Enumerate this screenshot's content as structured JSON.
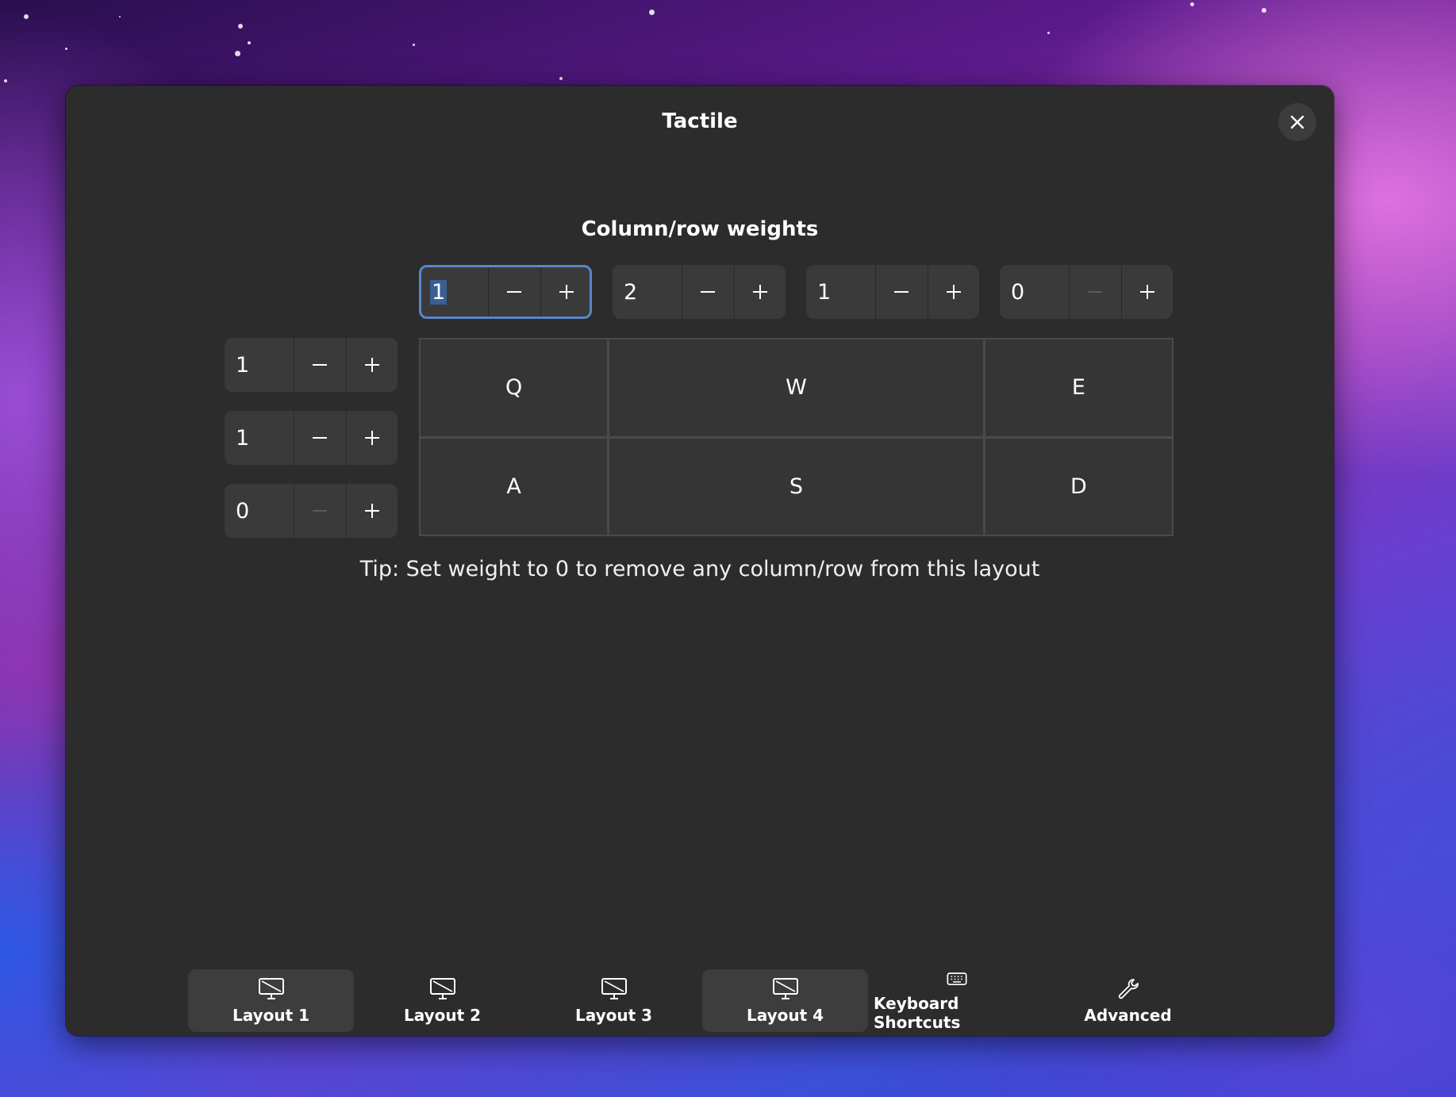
{
  "window": {
    "title": "Tactile",
    "close_icon": "close-icon"
  },
  "weights": {
    "title": "Column/row weights",
    "columns": [
      {
        "value": "1",
        "focused": true,
        "minus_enabled": true
      },
      {
        "value": "2",
        "focused": false,
        "minus_enabled": true
      },
      {
        "value": "1",
        "focused": false,
        "minus_enabled": true
      },
      {
        "value": "0",
        "focused": false,
        "minus_enabled": false
      }
    ],
    "rows": [
      {
        "value": "1",
        "minus_enabled": true
      },
      {
        "value": "1",
        "minus_enabled": true
      },
      {
        "value": "0",
        "minus_enabled": false
      }
    ]
  },
  "grid": {
    "cells": [
      "Q",
      "W",
      "E",
      "A",
      "S",
      "D"
    ]
  },
  "tip": "Tip: Set weight to 0 to remove any column/row from this layout",
  "tabs": [
    {
      "label": "Layout 1",
      "icon": "monitor-icon",
      "active": true
    },
    {
      "label": "Layout 2",
      "icon": "monitor-icon",
      "active": false
    },
    {
      "label": "Layout 3",
      "icon": "monitor-icon",
      "active": false
    },
    {
      "label": "Layout 4",
      "icon": "monitor-icon",
      "active": true
    },
    {
      "label": "Keyboard Shortcuts",
      "icon": "keyboard-icon",
      "active": false
    },
    {
      "label": "Advanced",
      "icon": "wrench-icon",
      "active": false
    }
  ],
  "colors": {
    "window_bg": "#2c2c2c",
    "focus_ring": "#5a86c8",
    "selection": "#3b5f94"
  }
}
